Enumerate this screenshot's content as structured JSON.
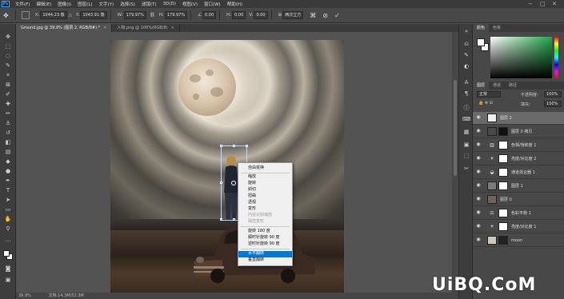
{
  "menubar": {
    "logo": "Ps",
    "items": [
      "文件(F)",
      "编辑(E)",
      "图像(I)",
      "图层(L)",
      "文字(Y)",
      "选择(S)",
      "滤镜(T)",
      "3D(D)",
      "视图(V)",
      "窗口(W)",
      "帮助(H)"
    ],
    "window_controls": [
      "−",
      "□",
      "✕"
    ]
  },
  "options_bar": {
    "x_label": "X:",
    "x_value": "1044.23 像",
    "y_label": "Y:",
    "y_value": "1043.91 像",
    "w_label": "W:",
    "w_value": "179.97%",
    "h_label": "H:",
    "h_value": "179.97%",
    "angle_value": "0.00",
    "hskew_label": "H:",
    "hskew_value": "0.00",
    "vskew_label": "V:",
    "vskew_value": "0.00",
    "interpolation": "两次立方",
    "cancel_icon": "cancel-icon",
    "commit_icon": "commit-icon"
  },
  "tabs": [
    {
      "label": "Ground.jpg @ 39.9% (图层 2, RGB/8#) *",
      "active": true
    },
    {
      "label": "人物.png @ 100%(RGB/8)",
      "active": false
    }
  ],
  "tools": [
    "move-icon",
    "marquee-icon",
    "lasso-icon",
    "quick-select-icon",
    "crop-icon",
    "frame-icon",
    "eyedropper-icon",
    "healing-icon",
    "brush-icon",
    "stamp-icon",
    "history-brush-icon",
    "eraser-icon",
    "gradient-icon",
    "blur-icon",
    "dodge-icon",
    "pen-icon",
    "type-icon",
    "path-select-icon",
    "shape-icon",
    "hand-icon",
    "zoom-icon"
  ],
  "context_menu": {
    "items": [
      {
        "label": "自由变换",
        "enabled": true
      },
      {
        "label": "缩放",
        "enabled": true
      },
      {
        "label": "旋转",
        "enabled": true
      },
      {
        "label": "斜切",
        "enabled": true
      },
      {
        "label": "扭曲",
        "enabled": true
      },
      {
        "label": "透视",
        "enabled": true
      },
      {
        "label": "变形",
        "enabled": true
      },
      {
        "label": "内容识别缩放",
        "enabled": false
      },
      {
        "label": "操控变形",
        "enabled": false
      },
      {
        "label": "旋转 180 度",
        "enabled": true
      },
      {
        "label": "顺时针旋转 90 度",
        "enabled": true
      },
      {
        "label": "逆时针旋转 90 度",
        "enabled": true
      },
      {
        "label": "水平翻转",
        "enabled": true,
        "highlighted": true
      },
      {
        "label": "垂直翻转",
        "enabled": true
      }
    ]
  },
  "statusbar": {
    "zoom": "39.9%",
    "doc": "文档:14.3M/52.3M"
  },
  "color_panel": {
    "tabs": [
      "颜色",
      "色板"
    ],
    "fg_color": "#ffffff",
    "bg_color": "#ffffff",
    "accent": "#1fa84a"
  },
  "layers_panel": {
    "tabs": [
      "图层",
      "通道",
      "路径"
    ],
    "blend_mode": "正常",
    "opacity_label": "不透明度:",
    "opacity": "100%",
    "fill_label": "填充:",
    "fill": "100%",
    "layers": [
      {
        "name": "图层 2",
        "selected": true,
        "kind": "pixel"
      },
      {
        "name": "图层 0 拷贝",
        "selected": false,
        "kind": "masked"
      },
      {
        "name": "色相/饱和度 1",
        "selected": false,
        "kind": "adjustment"
      },
      {
        "name": "亮度/对比度 2",
        "selected": false,
        "kind": "adjustment"
      },
      {
        "name": "通道混合器 1",
        "selected": false,
        "kind": "adjustment"
      },
      {
        "name": "图层 1",
        "selected": false,
        "kind": "masked"
      },
      {
        "name": "图层 0",
        "selected": false,
        "kind": "pixel"
      },
      {
        "name": "色彩平衡 1",
        "selected": false,
        "kind": "adjustment"
      },
      {
        "name": "亮度/对比度 1",
        "selected": false,
        "kind": "adjustment"
      },
      {
        "name": "moon",
        "selected": false,
        "kind": "masked"
      }
    ]
  },
  "watermark": "UiBQ.CoM"
}
